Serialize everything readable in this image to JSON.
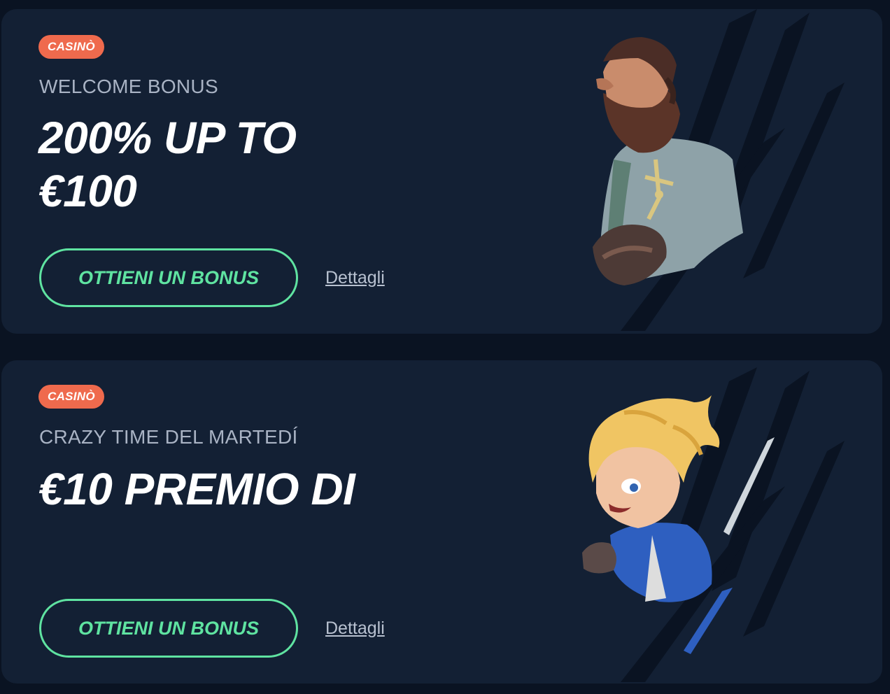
{
  "promos": [
    {
      "badge": "CASINÒ",
      "subtitle": "WELCOME BONUS",
      "headline": "200% UP TO €100",
      "cta_label": "OTTIENI UN BONUS",
      "details_label": "Dettagli",
      "character": "bearded-explorer-icon"
    },
    {
      "badge": "CASINÒ",
      "subtitle": "CRAZY TIME DEL MARTEDÍ",
      "headline": "€10 PREMIO DI",
      "cta_label": "OTTIENI UN BONUS",
      "details_label": "Dettagli",
      "character": "blonde-hero-icon"
    }
  ],
  "colors": {
    "page_bg": "#0a1322",
    "card_bg": "#132034",
    "badge": "#ef6a4d",
    "accent": "#5fe3a1",
    "subtitle": "#a9b3c4",
    "slash": "#0a1322"
  }
}
